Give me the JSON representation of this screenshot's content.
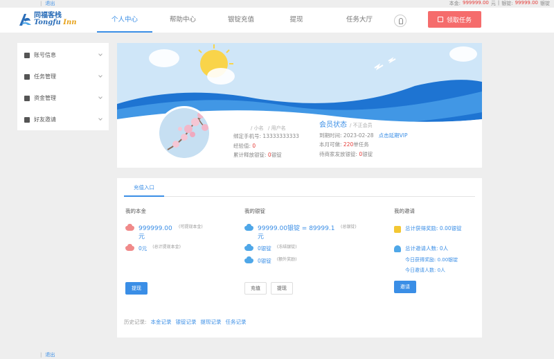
{
  "top": {
    "logout": "退出",
    "balance_label": "本金:",
    "balance_value": "999999.00",
    "balance_unit": "元",
    "silver_label": "银锭:",
    "silver_value": "99999.00",
    "silver_unit": "银锭"
  },
  "logo": {
    "cn": "同福客栈",
    "en_a": "Tongfu",
    "en_b": "Inn"
  },
  "nav": {
    "items": [
      {
        "label": "个人中心"
      },
      {
        "label": "帮助中心"
      },
      {
        "label": "银锭充值"
      },
      {
        "label": "提现"
      },
      {
        "label": "任务大厅"
      }
    ]
  },
  "task_button": "领取任务",
  "sidebar": {
    "items": [
      {
        "label": "账号信息",
        "icon": "user-icon"
      },
      {
        "label": "任务管理",
        "icon": "list-icon"
      },
      {
        "label": "资金管理",
        "icon": "money-bag-icon"
      },
      {
        "label": "好友邀请",
        "icon": "envelope-icon"
      }
    ]
  },
  "profile": {
    "nickname": "/ 小名",
    "username": "/ 用户名",
    "phone_label": "绑定手机号:",
    "phone_value": "13333333333",
    "exp_label": "经验值:",
    "exp_value": "0",
    "total_label": "累计释放银锭:",
    "total_value": "0",
    "total_unit": "银锭",
    "status_title": "会员状态",
    "status_sub": "/ 不正会员",
    "expire_label": "到期时间:",
    "expire_value": "2023-02-28",
    "renew_label": "点击延期VIP",
    "month_label": "本月可做:",
    "month_value": "220",
    "month_unit": "单任务",
    "pending_label": "待商家发放银锭:",
    "pending_value": "0",
    "pending_unit": "银锭"
  },
  "panel": {
    "tab": "充值入口",
    "principal": {
      "title": "我的本金",
      "amount": "999999.00",
      "amount_unit": "元",
      "amount_note": "(可提现本金)",
      "frozen": "0元",
      "frozen_note": "(总计提现本金)",
      "button": "提现"
    },
    "silver": {
      "title": "我的银锭",
      "amount": "99999.00银锭 = 89999.1元",
      "amount_note": "(总银锭)",
      "row2_value": "0银锭",
      "row2_note": "(冻结银锭)",
      "row3_value": "0银锭",
      "row3_note": "(额外奖励)",
      "button_a": "充值",
      "button_b": "提现"
    },
    "invite": {
      "title": "我的邀请",
      "reward_label": "总计获得奖励:",
      "reward_value": "0.00银锭",
      "count_label": "总计邀请人数:",
      "count_value": "0人",
      "today_reward": "今日获得奖励: 0.00银锭",
      "today_count": "今日邀请人数: 0人",
      "button": "邀请"
    },
    "history": {
      "label": "历史记录:",
      "links": [
        "本金记录",
        "银锭记录",
        "提现记录",
        "任务记录"
      ]
    }
  },
  "footer": {
    "logout": "退出"
  },
  "colors": {
    "accent": "#3a8ee6",
    "danger": "#f56c6c",
    "value_red": "#e53935"
  }
}
